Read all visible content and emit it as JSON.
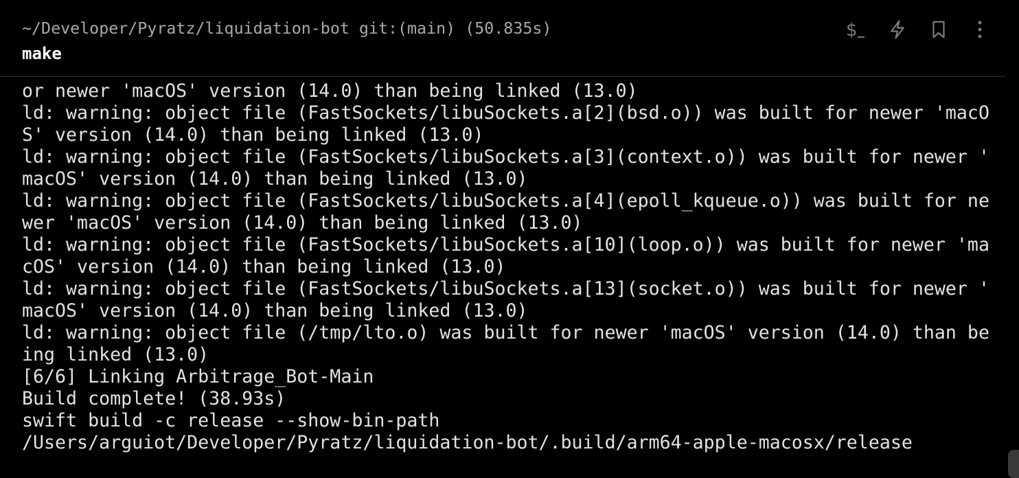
{
  "block": {
    "cwd": "~/Developer/Pyratz/liquidation-bot git:(main) (50.835s)",
    "command": "make",
    "icons": [
      "terminal-dollar-icon",
      "lightning-icon",
      "bookmark-icon",
      "more-vertical-icon"
    ]
  },
  "output": [
    "or newer 'macOS' version (14.0) than being linked (13.0)",
    "ld: warning: object file (FastSockets/libuSockets.a[2](bsd.o)) was built for newer 'macO",
    "S' version (14.0) than being linked (13.0)",
    "ld: warning: object file (FastSockets/libuSockets.a[3](context.o)) was built for newer '",
    "macOS' version (14.0) than being linked (13.0)",
    "ld: warning: object file (FastSockets/libuSockets.a[4](epoll_kqueue.o)) was built for ne",
    "wer 'macOS' version (14.0) than being linked (13.0)",
    "ld: warning: object file (FastSockets/libuSockets.a[10](loop.o)) was built for newer 'ma",
    "cOS' version (14.0) than being linked (13.0)",
    "ld: warning: object file (FastSockets/libuSockets.a[13](socket.o)) was built for newer '",
    "macOS' version (14.0) than being linked (13.0)",
    "ld: warning: object file (/tmp/lto.o) was built for newer 'macOS' version (14.0) than be",
    "ing linked (13.0)",
    "[6/6] Linking Arbitrage_Bot-Main",
    "Build complete! (38.93s)",
    "swift build -c release --show-bin-path",
    "/Users/arguiot/Developer/Pyratz/liquidation-bot/.build/arm64-apple-macosx/release"
  ]
}
